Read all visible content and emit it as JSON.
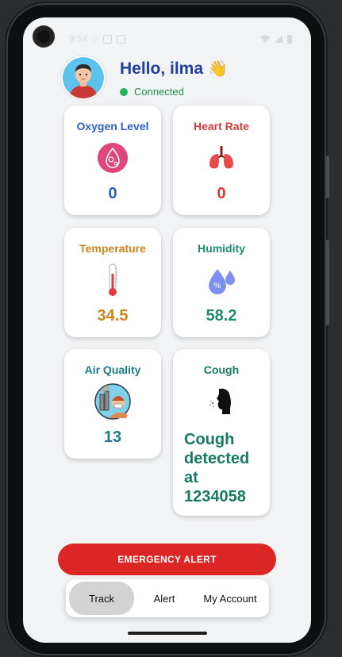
{
  "status_bar": {
    "time": "9:54"
  },
  "header": {
    "greeting": "Hello, ilma",
    "wave_emoji": "👋",
    "connection_status": "Connected"
  },
  "cards": {
    "oxygen": {
      "title": "Oxygen Level",
      "value": "0",
      "icon": "oxygen-drop-icon",
      "color": "#2f5fc4"
    },
    "heart": {
      "title": "Heart Rate",
      "value": "0",
      "icon": "lungs-icon",
      "color": "#d23b3b"
    },
    "temperature": {
      "title": "Temperature",
      "value": "34.5",
      "icon": "thermometer-icon",
      "color": "#c98516"
    },
    "humidity": {
      "title": "Humidity",
      "value": "58.2",
      "icon": "humidity-drop-icon",
      "color": "#1f8a6c"
    },
    "air": {
      "title": "Air Quality",
      "value": "13",
      "icon": "air-pollution-icon",
      "color": "#1c7a8a"
    },
    "cough": {
      "title": "Cough",
      "message": "Cough detected at 1234058",
      "icon": "cough-icon",
      "color": "#167a62"
    }
  },
  "emergency_button": {
    "label": "EMERGENCY ALERT",
    "color": "#dc2525"
  },
  "nav": {
    "items": [
      {
        "label": "Track",
        "active": true
      },
      {
        "label": "Alert",
        "active": false
      },
      {
        "label": "My Account",
        "active": false
      }
    ]
  }
}
